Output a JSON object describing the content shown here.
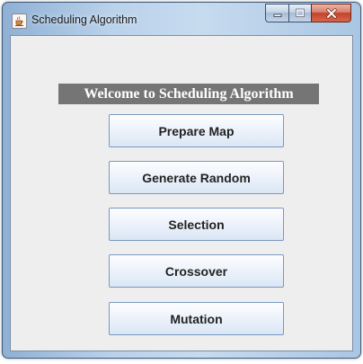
{
  "window": {
    "title": "Scheduling Algorithm",
    "icon": "java-cup-icon",
    "controls": [
      "minimize-icon",
      "maximize-icon",
      "close-icon"
    ]
  },
  "main": {
    "welcome_text": "Welcome to Scheduling Algorithm",
    "buttons": [
      {
        "label": "Prepare Map"
      },
      {
        "label": "Generate Random"
      },
      {
        "label": "Selection"
      },
      {
        "label": "Crossover"
      },
      {
        "label": "Mutation"
      }
    ]
  },
  "colors": {
    "banner_bg": "#757575",
    "banner_text": "#ffffff",
    "client_bg": "#eeeeee",
    "button_border": "#7a99c0",
    "close_button": "#c2432b"
  }
}
